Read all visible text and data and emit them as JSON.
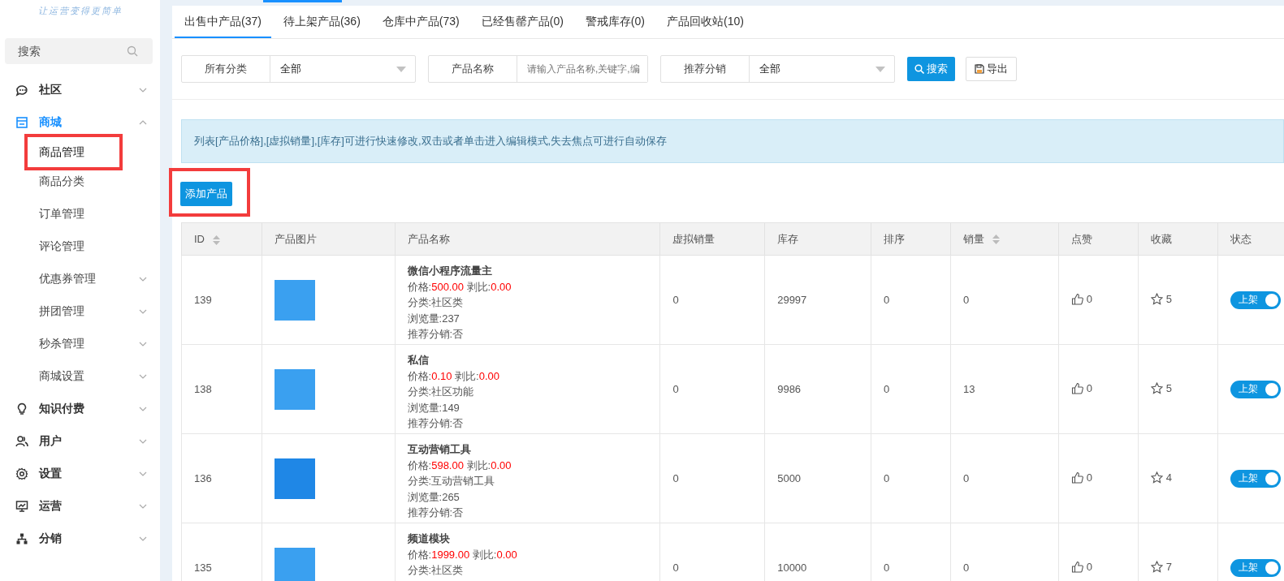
{
  "sidebar": {
    "slogan": "让运营变得更简单",
    "search": {
      "placeholder": "搜索"
    },
    "items": [
      {
        "label": "社区",
        "expanded": false,
        "selected": false
      },
      {
        "label": "商城",
        "expanded": true,
        "selected": true,
        "children": [
          {
            "label": "商品管理",
            "selected": true,
            "highlighted": true,
            "has_submenu": false
          },
          {
            "label": "商品分类",
            "selected": false,
            "highlighted": false,
            "has_submenu": false
          },
          {
            "label": "订单管理",
            "selected": false,
            "highlighted": false,
            "has_submenu": false
          },
          {
            "label": "评论管理",
            "selected": false,
            "highlighted": false,
            "has_submenu": false
          },
          {
            "label": "优惠券管理",
            "selected": false,
            "highlighted": false,
            "has_submenu": true
          },
          {
            "label": "拼团管理",
            "selected": false,
            "highlighted": false,
            "has_submenu": true
          },
          {
            "label": "秒杀管理",
            "selected": false,
            "highlighted": false,
            "has_submenu": true
          },
          {
            "label": "商城设置",
            "selected": false,
            "highlighted": false,
            "has_submenu": true
          }
        ]
      },
      {
        "label": "知识付费",
        "expanded": false,
        "selected": false
      },
      {
        "label": "用户",
        "expanded": false,
        "selected": false
      },
      {
        "label": "设置",
        "expanded": false,
        "selected": false
      },
      {
        "label": "运营",
        "expanded": false,
        "selected": false
      },
      {
        "label": "分销",
        "expanded": false,
        "selected": false
      }
    ]
  },
  "tabs": [
    {
      "label": "出售中产品(37)",
      "selected": true
    },
    {
      "label": "待上架产品(36)",
      "selected": false
    },
    {
      "label": "仓库中产品(73)",
      "selected": false
    },
    {
      "label": "已经售罄产品(0)",
      "selected": false
    },
    {
      "label": "警戒库存(0)",
      "selected": false
    },
    {
      "label": "产品回收站(10)",
      "selected": false
    }
  ],
  "filters": [
    {
      "kind": "select",
      "label": "所有分类",
      "value": "全部"
    },
    {
      "kind": "input",
      "label": "产品名称",
      "placeholder": "请输入产品名称,关键字,编"
    },
    {
      "kind": "select",
      "label": "推荐分销",
      "value": "全部"
    }
  ],
  "search_button": "搜索",
  "export_button": "导出",
  "notice": "列表[产品价格],[虚拟销量],[库存]可进行快速修改,双击或者单击进入编辑模式,失去焦点可进行自动保存",
  "add_button": {
    "label": "添加产品",
    "highlighted": true
  },
  "table": {
    "columns": [
      {
        "label": "ID",
        "sortable": true
      },
      {
        "label": "产品图片",
        "sortable": false
      },
      {
        "label": "产品名称",
        "sortable": false
      },
      {
        "label": "虚拟销量",
        "sortable": false
      },
      {
        "label": "库存",
        "sortable": false
      },
      {
        "label": "排序",
        "sortable": false
      },
      {
        "label": "销量",
        "sortable": true
      },
      {
        "label": "点赞",
        "sortable": false
      },
      {
        "label": "收藏",
        "sortable": false
      },
      {
        "label": "状态",
        "sortable": false
      }
    ],
    "rows": [
      {
        "id": "139",
        "name": "微信小程序流量主",
        "price_label": "价格:",
        "price": "500.00",
        "ratio_label": "剥比:",
        "ratio": "0.00",
        "details": [
          "分类:社区类",
          "浏览量:237",
          "推荐分销:否"
        ],
        "virtual_sales": "0",
        "stock": "29997",
        "sort": "0",
        "sales": "0",
        "likes": "0",
        "favorites": "5",
        "status": {
          "label": "上架",
          "on": true
        }
      },
      {
        "id": "138",
        "name": "私信",
        "price_label": "价格:",
        "price": "0.10",
        "ratio_label": "剥比:",
        "ratio": "0.00",
        "details": [
          "分类:社区功能",
          "浏览量:149",
          "推荐分销:否"
        ],
        "virtual_sales": "0",
        "stock": "9986",
        "sort": "0",
        "sales": "13",
        "likes": "0",
        "favorites": "5",
        "status": {
          "label": "上架",
          "on": true
        }
      },
      {
        "id": "136",
        "name": "互动营销工具",
        "price_label": "价格:",
        "price": "598.00",
        "ratio_label": "剥比:",
        "ratio": "0.00",
        "details": [
          "分类:互动营销工具",
          "浏览量:265",
          "推荐分销:否"
        ],
        "virtual_sales": "0",
        "stock": "5000",
        "sort": "0",
        "sales": "0",
        "likes": "0",
        "favorites": "4",
        "status": {
          "label": "上架",
          "on": true
        }
      },
      {
        "id": "135",
        "name": "频道模块",
        "price_label": "价格:",
        "price": "1999.00",
        "ratio_label": "剥比:",
        "ratio": "0.00",
        "details": [
          "分类:社区类"
        ],
        "virtual_sales": "0",
        "stock": "10000",
        "sort": "0",
        "sales": "0",
        "likes": "0",
        "favorites": "7",
        "status": {
          "label": "上架",
          "on": true
        }
      }
    ]
  }
}
